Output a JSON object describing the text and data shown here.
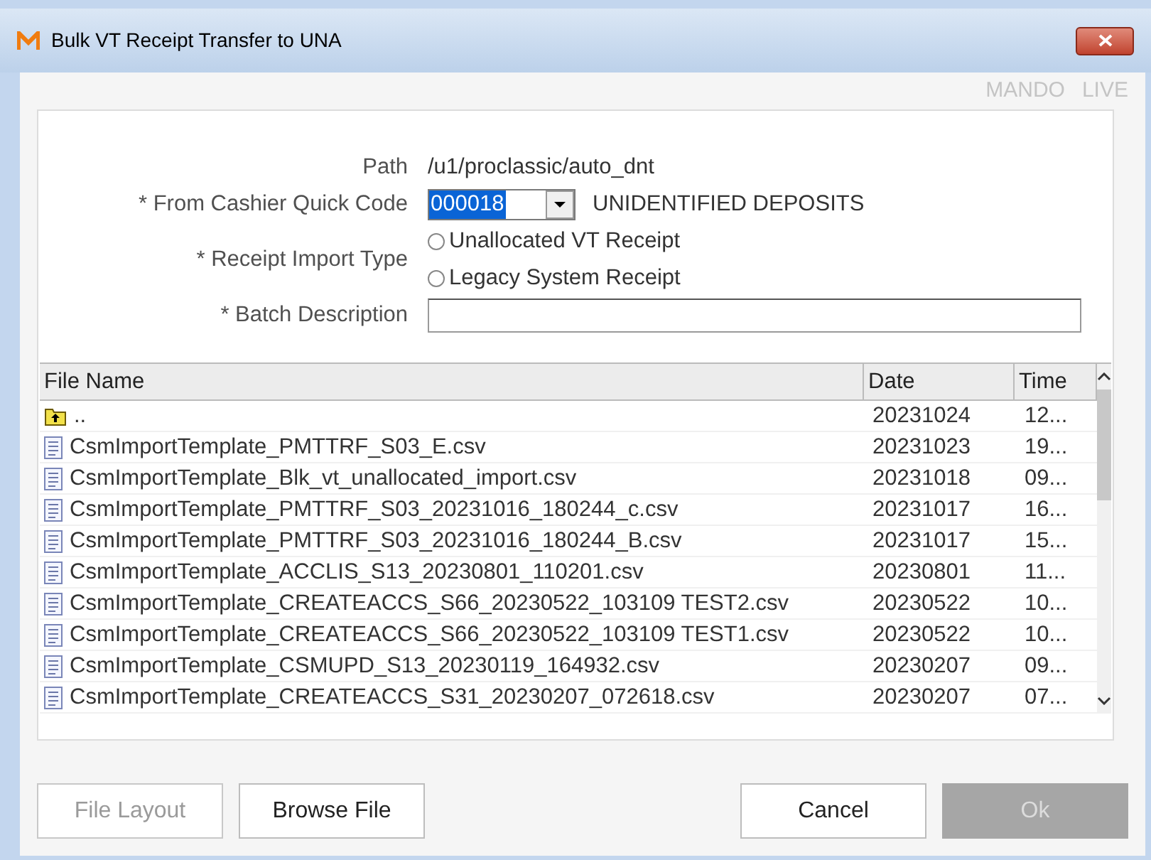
{
  "window": {
    "title": "Bulk VT Receipt Transfer to UNA",
    "brand": "MANDO",
    "environment": "LIVE"
  },
  "form": {
    "path_label": "Path",
    "path_value": "/u1/proclassic/auto_dnt",
    "cashier_label": "* From Cashier Quick Code",
    "cashier_code": "000018",
    "cashier_name": "UNIDENTIFIED DEPOSITS",
    "import_type_label": "* Receipt Import Type",
    "import_types": [
      {
        "label": "Unallocated VT Receipt",
        "selected": false
      },
      {
        "label": "Legacy System Receipt",
        "selected": false
      }
    ],
    "batch_label": "* Batch Description"
  },
  "table": {
    "columns": [
      "File Name",
      "Date",
      "Time"
    ],
    "rows": [
      {
        "kind": "parent",
        "name": "..",
        "date": "20231024",
        "time": "12..."
      },
      {
        "kind": "file",
        "name": "CsmImportTemplate_PMTTRF_S03_E.csv",
        "date": "20231023",
        "time": "19..."
      },
      {
        "kind": "file",
        "name": "CsmImportTemplate_Blk_vt_unallocated_import.csv",
        "date": "20231018",
        "time": "09..."
      },
      {
        "kind": "file",
        "name": "CsmImportTemplate_PMTTRF_S03_20231016_180244_c.csv",
        "date": "20231017",
        "time": "16..."
      },
      {
        "kind": "file",
        "name": "CsmImportTemplate_PMTTRF_S03_20231016_180244_B.csv",
        "date": "20231017",
        "time": "15..."
      },
      {
        "kind": "file",
        "name": "CsmImportTemplate_ACCLIS_S13_20230801_110201.csv",
        "date": "20230801",
        "time": "11..."
      },
      {
        "kind": "file",
        "name": "CsmImportTemplate_CREATEACCS_S66_20230522_103109 TEST2.csv",
        "date": "20230522",
        "time": "10..."
      },
      {
        "kind": "file",
        "name": "CsmImportTemplate_CREATEACCS_S66_20230522_103109 TEST1.csv",
        "date": "20230522",
        "time": "10..."
      },
      {
        "kind": "file",
        "name": "CsmImportTemplate_CSMUPD_S13_20230119_164932.csv",
        "date": "20230207",
        "time": "09..."
      },
      {
        "kind": "file",
        "name": "CsmImportTemplate_CREATEACCS_S31_20230207_072618.csv",
        "date": "20230207",
        "time": "07..."
      }
    ]
  },
  "left_buttons": [
    {
      "label": "File Layout",
      "disabled": true
    },
    {
      "label": "Browse File",
      "disabled": false
    }
  ],
  "right_buttons": [
    {
      "label": "Cancel",
      "disabled": false
    },
    {
      "label": "Ok",
      "disabled": true
    }
  ]
}
